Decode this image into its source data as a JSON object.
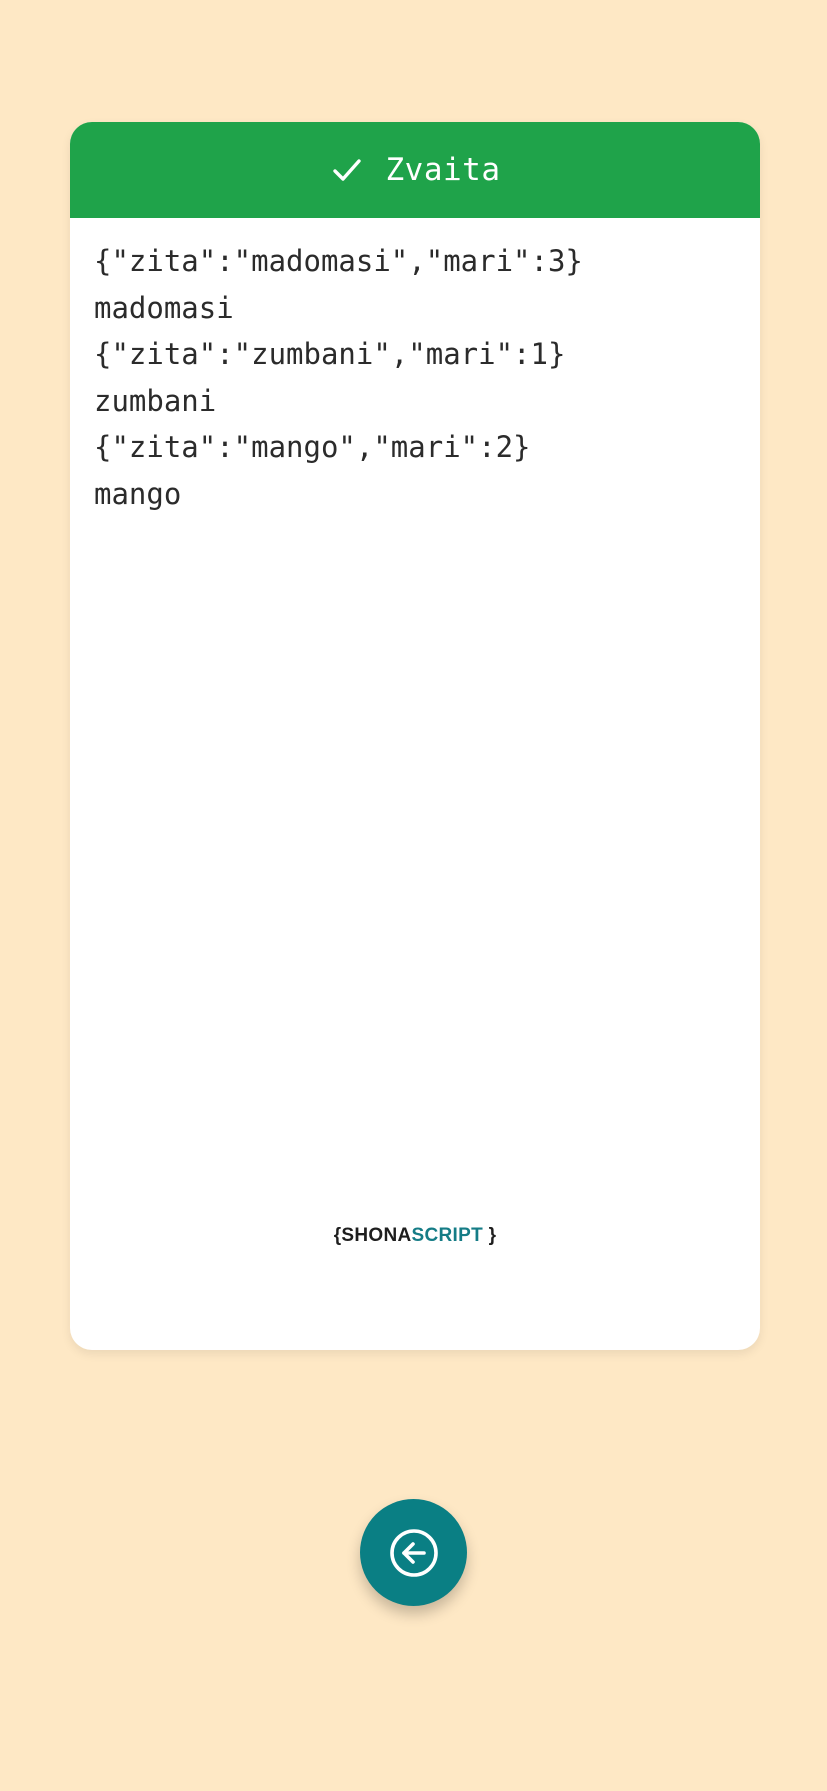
{
  "header": {
    "icon": "check-icon",
    "title": "Zvaita",
    "color": "#1FA34A"
  },
  "output_lines": [
    "{\"zita\":\"madomasi\",\"mari\":3}",
    "madomasi",
    "{\"zita\":\"zumbani\",\"mari\":1}",
    "zumbani",
    "{\"zita\":\"mango\",\"mari\":2}",
    "mango"
  ],
  "brand": {
    "open": "{",
    "part1": "SHONA",
    "part2": "SCRIPT",
    "close": "}"
  },
  "back_button": {
    "icon": "arrow-left-circle-icon",
    "color": "#0A7F84"
  },
  "background_color": "#FEE8C5"
}
